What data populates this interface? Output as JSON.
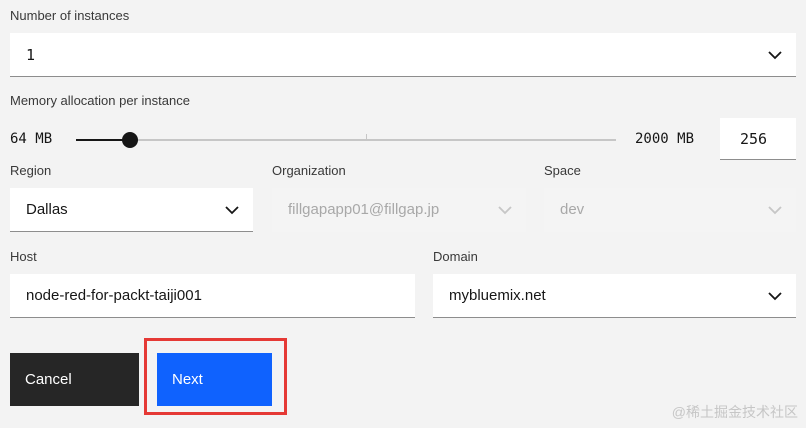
{
  "instances": {
    "label": "Number of instances",
    "value": "1"
  },
  "memory": {
    "label": "Memory allocation per instance",
    "min_label": "64 MB",
    "max_label": "2000 MB",
    "value": "256",
    "slider_fraction": 0.1
  },
  "region": {
    "label": "Region",
    "value": "Dallas"
  },
  "organization": {
    "label": "Organization",
    "value": "fillgapapp01@fillgap.jp"
  },
  "space": {
    "label": "Space",
    "value": "dev"
  },
  "host": {
    "label": "Host",
    "value": "node-red-for-packt-taiji001"
  },
  "domain": {
    "label": "Domain",
    "value": "mybluemix.net"
  },
  "buttons": {
    "cancel": "Cancel",
    "next": "Next"
  },
  "colors": {
    "primary": "#0f62fe",
    "dark": "#262626",
    "highlight": "#e53935"
  },
  "watermark": "@稀土掘金技术社区"
}
